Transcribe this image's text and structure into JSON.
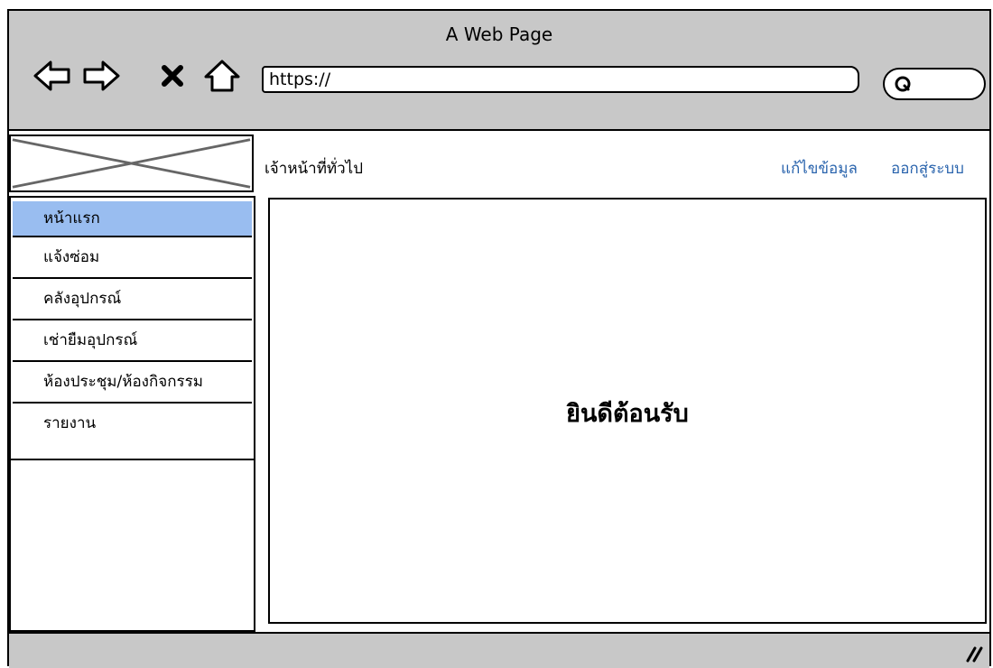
{
  "window": {
    "title": "A Web Page"
  },
  "toolbar": {
    "back_icon": "back-arrow-icon",
    "forward_icon": "forward-arrow-icon",
    "stop_icon": "close-icon",
    "home_icon": "home-icon",
    "url": "https://",
    "search_icon": "search-icon"
  },
  "header": {
    "role": "เจ้าหน้าที่ทั่วไป",
    "edit_label": "แก้ไขข้อมูล",
    "logout_label": "ออกสู่ระบบ",
    "link_color": "#2a64ad"
  },
  "sidebar": {
    "logo": "logo-placeholder",
    "active_color": "#99bdf0",
    "items": [
      {
        "label": "หน้าแรก",
        "active": true
      },
      {
        "label": "แจ้งซ่อม",
        "active": false
      },
      {
        "label": "คลังอุปกรณ์",
        "active": false
      },
      {
        "label": "เช่ายืมอุปกรณ์",
        "active": false
      },
      {
        "label": "ห้องประชุม/ห้องกิจกรรม",
        "active": false
      },
      {
        "label": "รายงาน",
        "active": false
      }
    ]
  },
  "main": {
    "welcome": "ยินดีต้อนรับ"
  },
  "chrome_color": "#c8c8c8"
}
